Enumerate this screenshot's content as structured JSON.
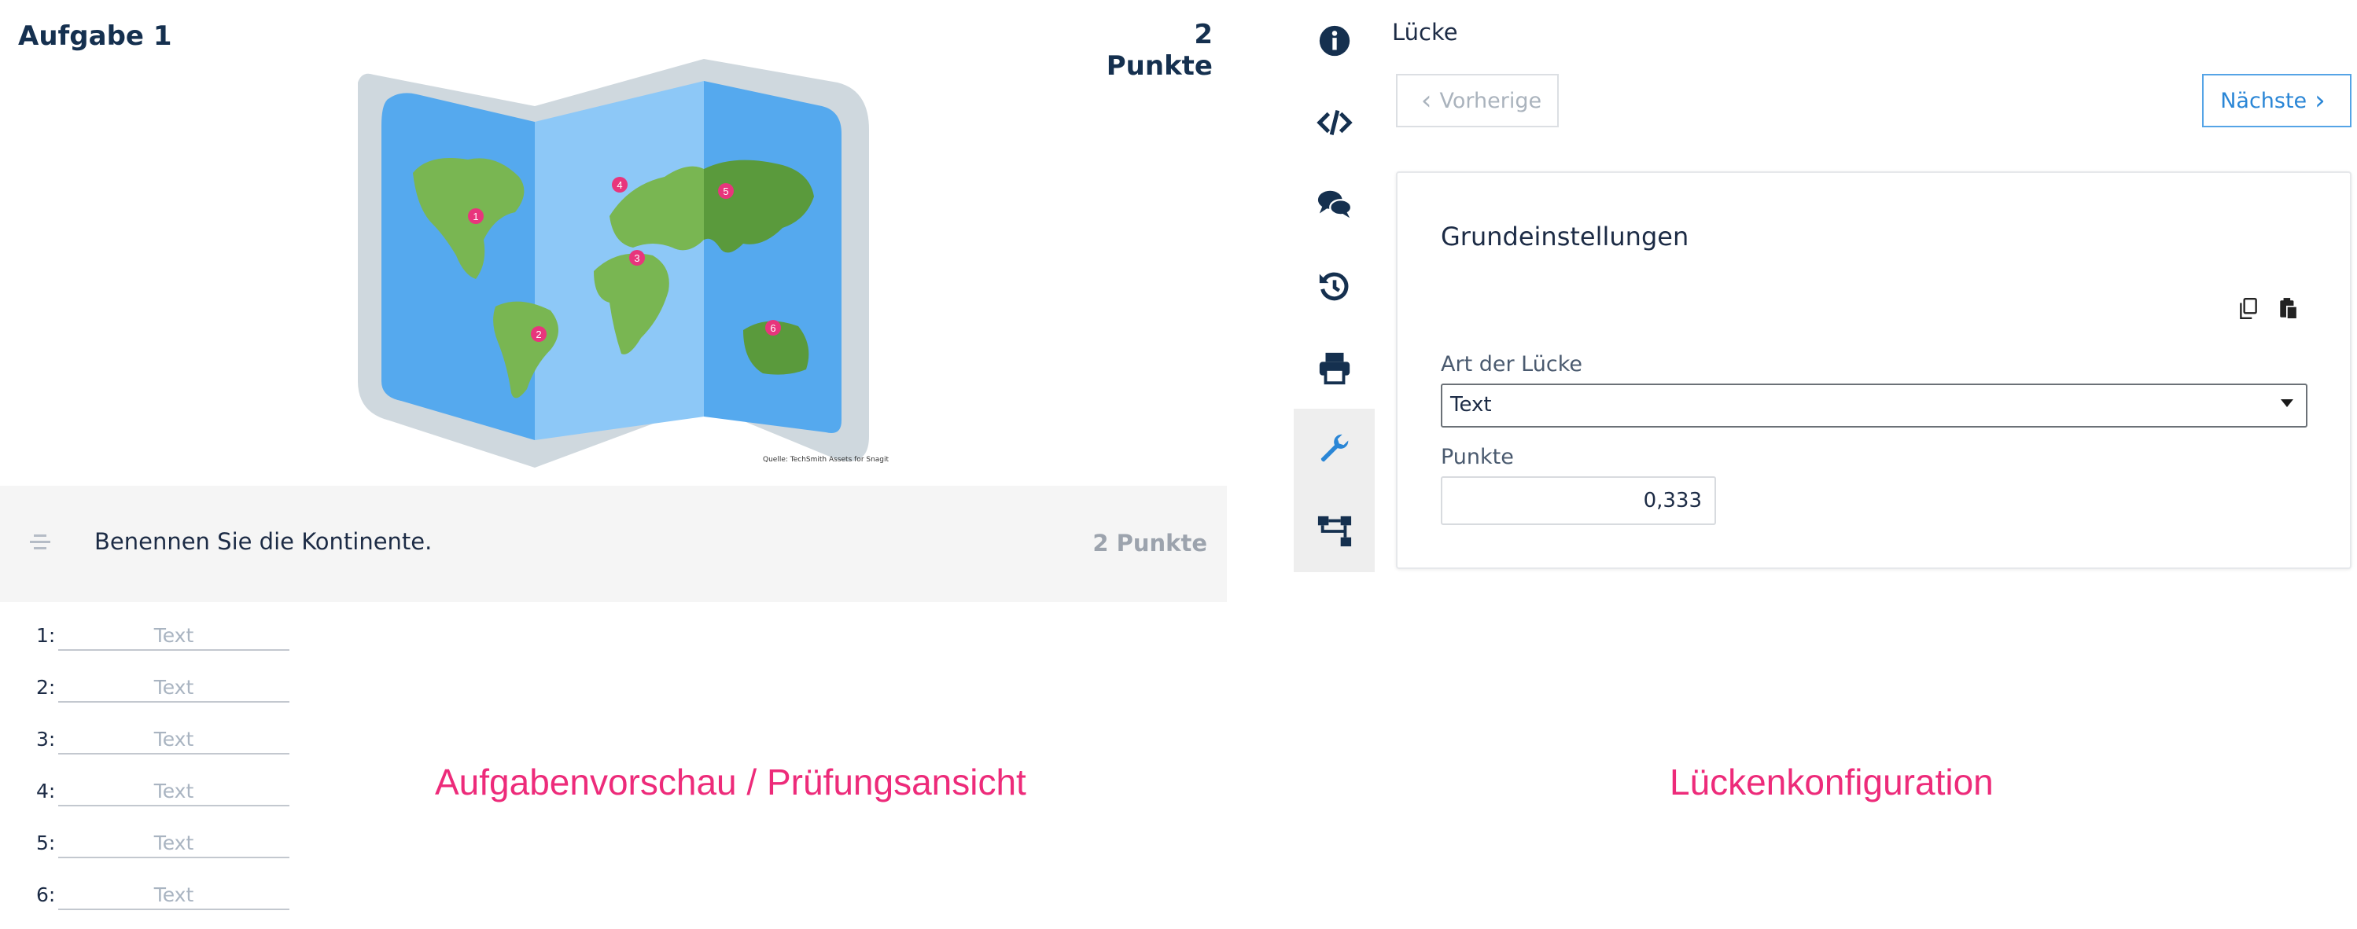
{
  "task": {
    "title": "Aufgabe 1",
    "points": "2 Punkte"
  },
  "image": {
    "caption": "Quelle: TechSmith Assets for Snagit"
  },
  "question": {
    "text": "Benennen Sie die Kontinente.",
    "points": "2 Punkte"
  },
  "map_markers": [
    "1",
    "2",
    "3",
    "4",
    "5",
    "6"
  ],
  "gaps": [
    {
      "number": "1:",
      "placeholder": "Text"
    },
    {
      "number": "2:",
      "placeholder": "Text"
    },
    {
      "number": "3:",
      "placeholder": "Text"
    },
    {
      "number": "4:",
      "placeholder": "Text"
    },
    {
      "number": "5:",
      "placeholder": "Text"
    },
    {
      "number": "6:",
      "placeholder": "Text"
    }
  ],
  "captions": {
    "left": "Aufgabenvorschau / Prüfungsansicht",
    "right": "Lückenkonfiguration"
  },
  "sidebar": {
    "items": [
      {
        "icon": "info-icon"
      },
      {
        "icon": "code-icon"
      },
      {
        "icon": "comments-icon"
      },
      {
        "icon": "history-icon"
      },
      {
        "icon": "print-icon"
      },
      {
        "icon": "wrench-icon",
        "active": true
      },
      {
        "icon": "sitemap-icon"
      }
    ]
  },
  "panel": {
    "title": "Lücke",
    "prev_label": "Vorherige",
    "next_label": "Nächste",
    "section_title": "Grundeinstellungen",
    "gap_type_label": "Art der Lücke",
    "gap_type_value": "Text",
    "points_label": "Punkte",
    "points_value": "0,333"
  },
  "colors": {
    "accent": "#2a86d6",
    "dark": "#15304f",
    "caption": "#ed2b7a",
    "marker": "#e8357c"
  }
}
